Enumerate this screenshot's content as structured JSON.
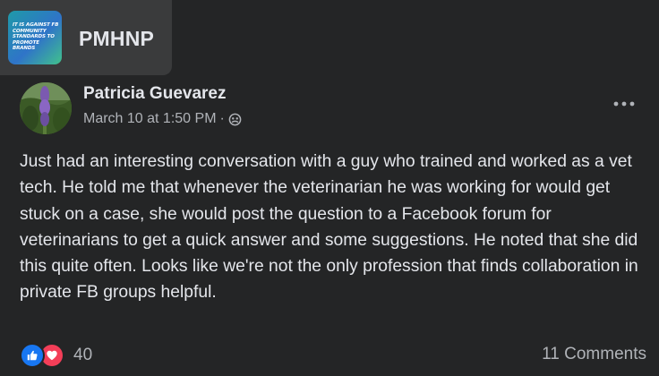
{
  "group": {
    "name": "PMHNP",
    "thumbnail_text": "IT IS AGAINST FB COMMUNITY STANDARDS TO PROMOTE BRANDS"
  },
  "post": {
    "author": "Patricia Guevarez",
    "timestamp": "March 10 at 1:50 PM",
    "separator": "·",
    "audience_icon": "group-audience-icon",
    "body": "Just had an interesting conversation with a guy who trained and worked as a vet tech. He told me that whenever the veterinarian he was working for would get stuck on a case, she would post the question to a Facebook forum for veterinarians to get a quick answer and some suggestions. He noted that she did this quite often. Looks like we're not the only profession that finds collaboration in private FB groups helpful."
  },
  "footer": {
    "reaction_count": "40",
    "comments_label": "11 Comments"
  },
  "colors": {
    "background": "#242526",
    "chip": "#3a3b3c",
    "text_primary": "#e4e6eb",
    "text_secondary": "#b0b3b8",
    "like": "#1877f2",
    "love": "#f33e58"
  }
}
